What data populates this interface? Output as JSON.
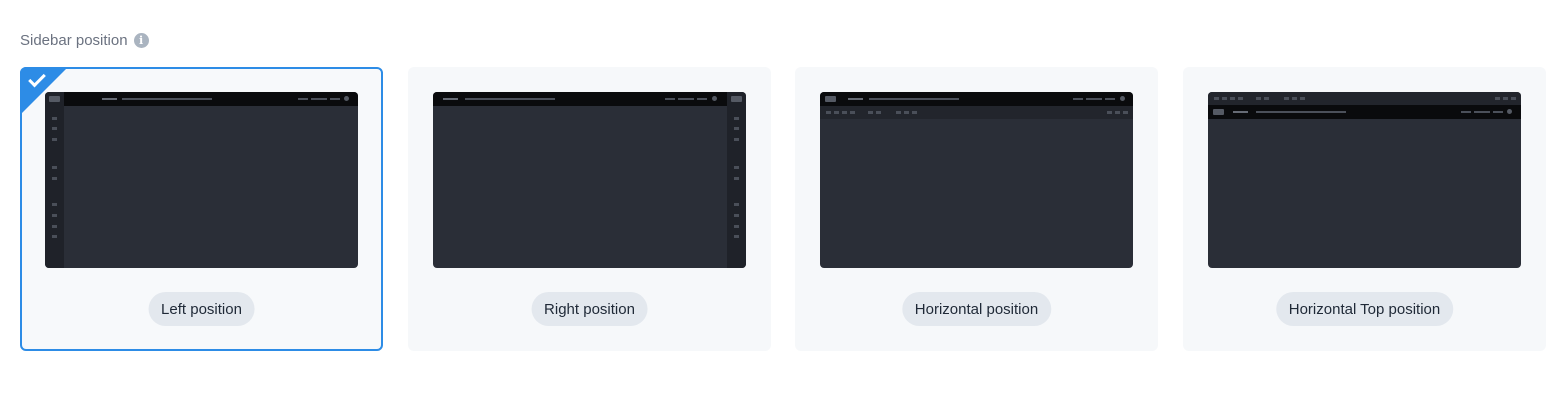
{
  "section": {
    "label": "Sidebar position",
    "info_icon": "info-icon"
  },
  "accent_color": "#2d8ce6",
  "options": [
    {
      "label": "Left position",
      "selected": true
    },
    {
      "label": "Right position",
      "selected": false
    },
    {
      "label": "Horizontal position",
      "selected": false
    },
    {
      "label": "Horizontal Top position",
      "selected": false
    }
  ]
}
